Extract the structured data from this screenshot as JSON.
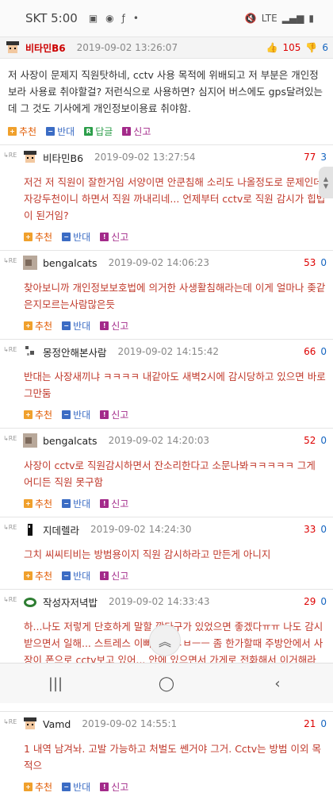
{
  "status": {
    "carrier": "SKT",
    "time": "5:00",
    "net": "LTE"
  },
  "post": {
    "author": "비타민B6",
    "date": "2019-09-02 13:26:07",
    "up": "105",
    "down": "6",
    "body": "저 사장이 문제지 직원탓하네, cctv 사용 목적에 위배되고 저 부분은 개인정보라 사용료 취야할걸? 저런식으로 사용하면? 심지어 버스에도 gps달려있는데 그 것도 기사에게 개인정보이용료 취야함.",
    "actions": [
      "추천",
      "반대",
      "답글",
      "신고"
    ]
  },
  "reply_label": "RE",
  "actions": [
    "추천",
    "반대",
    "신고"
  ],
  "replies": [
    {
      "author": "비타민B6",
      "date": "2019-09-02 13:27:54",
      "score": "77",
      "score2": "3",
      "body": "저건 저 직원이 잘한거임 서양이면 안쿤침해 소리도 나올정도로 문제인데 자강두천이니 하면서 직원 까내리네... 언제부터 cctv로 직원 감시가 힙법이 된거임?"
    },
    {
      "author": "bengalcats",
      "date": "2019-09-02 14:06:23",
      "score": "53",
      "score2": "0",
      "body": "찾아보니까 개인정보보호법에 의거한 사생활침해라는데 이게 얼마나 좆같은지모르는사람많은듯"
    },
    {
      "author": "몽정안해본사람",
      "date": "2019-09-02 14:15:42",
      "score": "66",
      "score2": "0",
      "body": "반대는 사장새끼냐 ㅋㅋㅋㅋ 내같아도 새벽2시에 감시당하고 있으면 바로 그만둠"
    },
    {
      "author": "bengalcats",
      "date": "2019-09-02 14:20:03",
      "score": "52",
      "score2": "0",
      "body": "사장이 cctv로 직원감시하면서 잔소리한다고 소문나봐ㅋㅋㅋㅋㅋ 그게 어디든 직원 못구함"
    },
    {
      "author": "지데렐라",
      "date": "2019-09-02 14:24:30",
      "score": "33",
      "score2": "0",
      "body": "그치 씨씨티비는 방범용이지 직원 감시하라고 만든게 아니지"
    },
    {
      "author": "작성자저녁밥",
      "date": "2019-09-02 14:33:43",
      "score": "29",
      "score2": "0",
      "body": "하...나도 저렇게 단호하게 말할 깡다구가 있었으면 좋겠다ㅠㅠ 나도 감시받으면서 일해... 스트레스 이빠이야 ㅅㅂㅡㅡ 좀 한가할때 주방안에서 사장이 폰으로 cctv보고 있어... 안에 있으면서 가게로 전화해서 이거해라 저거해라해..하.. 살..려..줘..."
    },
    {
      "author": "Vamd",
      "date": "2019-09-02 14:55:1",
      "score": "21",
      "score2": "0",
      "body": "1 내역 남겨놔. 고발 가능하고 처벌도 쎈거야 그거. Cctv는 방범 이외 목적으"
    }
  ],
  "colors": {
    "accent": "#c0392b",
    "up": "#dd0000",
    "down": "#1565c0"
  }
}
